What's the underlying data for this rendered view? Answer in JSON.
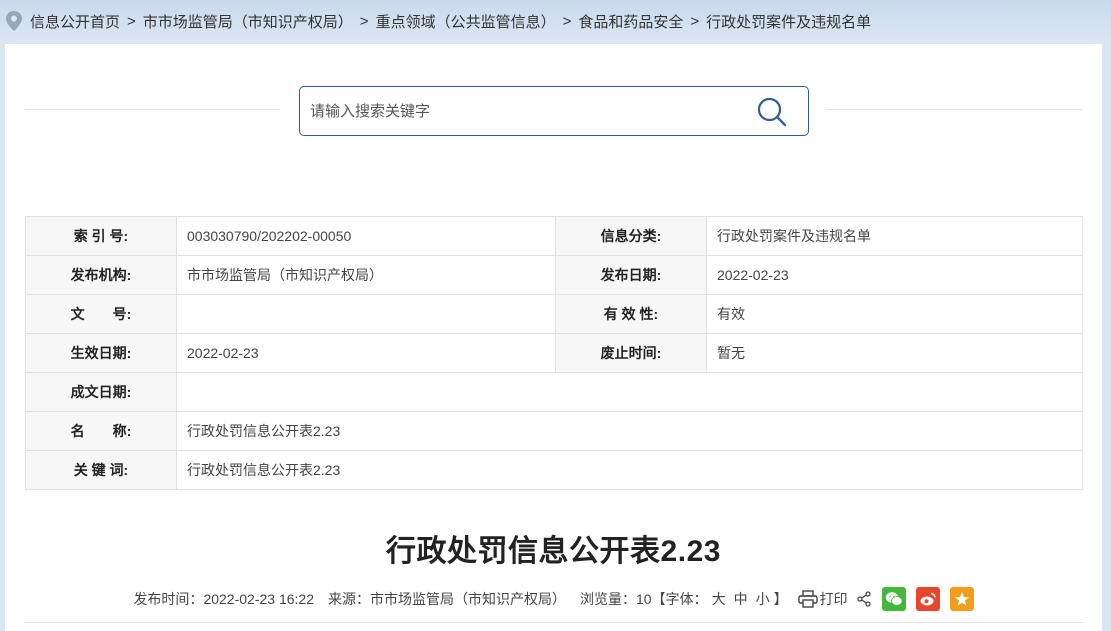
{
  "breadcrumb": {
    "items": [
      "信息公开首页",
      "市市场监管局（市知识产权局）",
      "重点领域（公共监管信息）",
      "食品和药品安全",
      "行政处罚案件及违规名单"
    ],
    "separator": ">"
  },
  "search": {
    "placeholder": "请输入搜索关键字",
    "icon": "search-icon"
  },
  "meta": {
    "index_label": "索 引 号:",
    "index_value": "003030790/202202-00050",
    "category_label": "信息分类:",
    "category_value": "行政处罚案件及违规名单",
    "publisher_label": "发布机构:",
    "publisher_value": "市市场监管局（市知识产权局）",
    "pubdate_label": "发布日期:",
    "pubdate_value": "2022-02-23",
    "docno_label": "文　　号:",
    "docno_value": "",
    "validity_label": "有 效 性:",
    "validity_value": "有效",
    "effective_label": "生效日期:",
    "effective_value": "2022-02-23",
    "expire_label": "废止时间:",
    "expire_value": "暂无",
    "written_label": "成文日期:",
    "written_value": "",
    "name_label": "名　　称:",
    "name_value": "行政处罚信息公开表2.23",
    "keywords_label": "关 键 词:",
    "keywords_value": "行政处罚信息公开表2.23"
  },
  "article": {
    "title": "行政处罚信息公开表2.23",
    "publish_time_label": "发布时间：",
    "publish_time": "2022-02-23 16:22",
    "source_label": "来源：",
    "source": "市市场监管局（市知识产权局）",
    "views_label": "浏览量：",
    "views": "10",
    "font_open": "【字体：",
    "font_large": "大",
    "font_medium": "中",
    "font_small": "小",
    "font_close": "】",
    "print_label": "打印"
  },
  "colors": {
    "accent": "#2f5e99",
    "wechat": "#43b83b",
    "weibo": "#e6462d",
    "favorite": "#f59c1a"
  }
}
